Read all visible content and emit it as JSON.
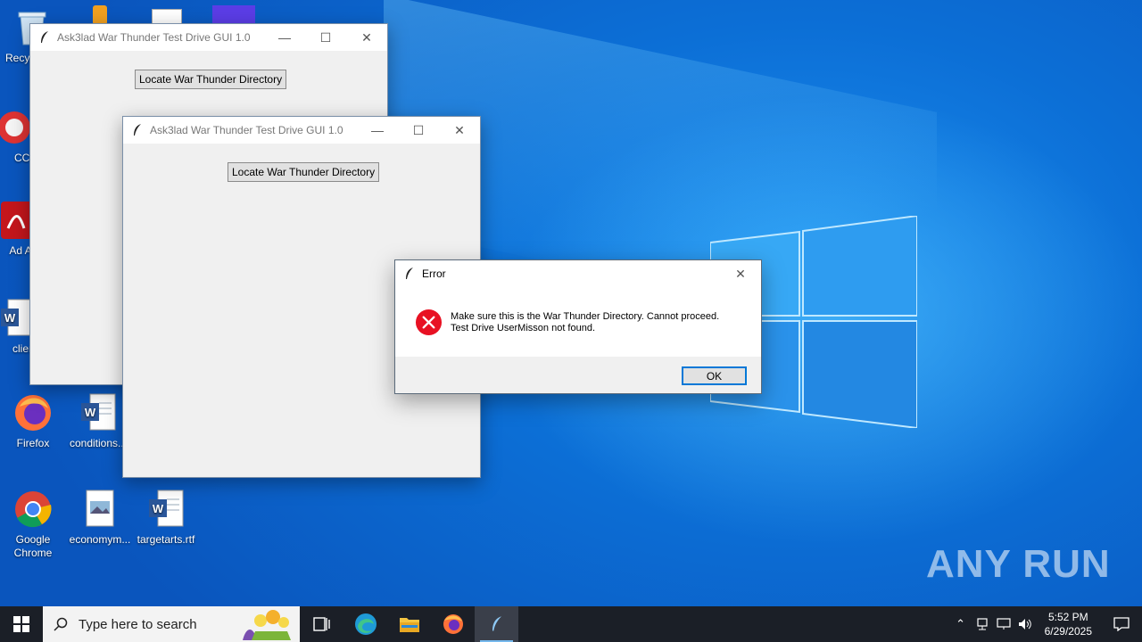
{
  "desktop": {
    "icons": [
      {
        "label": "Recy"
      },
      {
        "label": "CCl"
      },
      {
        "label": "Ad Acr"
      },
      {
        "label": "client"
      },
      {
        "label": "Firefox"
      },
      {
        "label": "conditions..."
      },
      {
        "label": "Google Chrome"
      },
      {
        "label": "economym..."
      },
      {
        "label": "targetarts.rtf"
      }
    ],
    "watermark": "ANY RUN"
  },
  "windows": [
    {
      "title": "Ask3lad War Thunder Test Drive GUI 1.0",
      "button_label": "Locate War Thunder Directory"
    },
    {
      "title": "Ask3lad War Thunder Test Drive GUI 1.0",
      "button_label": "Locate War Thunder Directory"
    }
  ],
  "dialog": {
    "title": "Error",
    "message_line1": "Make sure this is the War Thunder Directory. Cannot proceed.",
    "message_line2": "Test Drive UserMisson not found.",
    "ok_label": "OK"
  },
  "taskbar": {
    "search_placeholder": "Type here to search",
    "time": "5:52 PM",
    "date": "6/29/2025"
  },
  "colors": {
    "wallpaper": "#0a6fd8",
    "taskbar": "#1b1f27",
    "accent": "#0078d7",
    "error": "#e81123"
  }
}
